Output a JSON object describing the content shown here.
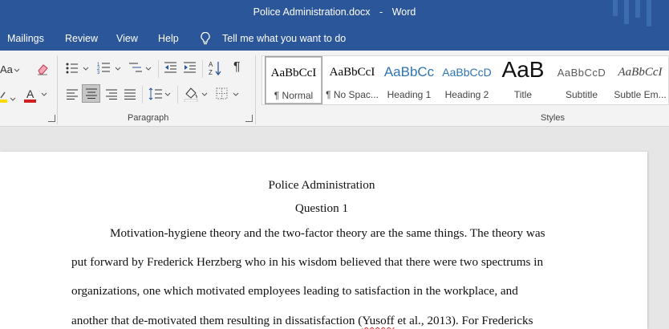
{
  "window": {
    "filename": "Police Administration.docx",
    "separator": "-",
    "app": "Word",
    "theme_color": "#2b579a"
  },
  "menu": {
    "items": [
      "Mailings",
      "Review",
      "View",
      "Help"
    ],
    "tell_me": "Tell me what you want to do"
  },
  "ribbon": {
    "font_size_label": "Aa",
    "paragraph_group": "Paragraph",
    "styles_group": "Styles",
    "styles": [
      {
        "sample": "AaBbCcI",
        "label": "¶ Normal",
        "selected": true
      },
      {
        "sample": "AaBbCcI",
        "label": "¶ No Spac..."
      },
      {
        "sample": "AaBbCc",
        "label": "Heading 1"
      },
      {
        "sample": "AaBbCcD",
        "label": "Heading 2"
      },
      {
        "sample": "AaB",
        "label": "Title"
      },
      {
        "sample": "AaBbCcD",
        "label": "Subtitle"
      },
      {
        "sample": "AaBbCcI",
        "label": "Subtle Em..."
      }
    ]
  },
  "document": {
    "title": "Police Administration",
    "subtitle": "Question 1",
    "lines": [
      "Motivation-hygiene theory and the two-factor theory are the same things. The theory was",
      "put forward by Frederick Herzberg who in his wisdom believed that there were two spectrums in",
      "organizations, one which motivated employees leading to satisfaction in the workplace, and"
    ],
    "line4_before": "another that de-motivated them resulting in dissatisfaction (",
    "line4_flagged": "Yusoff",
    "line4_after": " et al., 2013). For Fredericks"
  }
}
